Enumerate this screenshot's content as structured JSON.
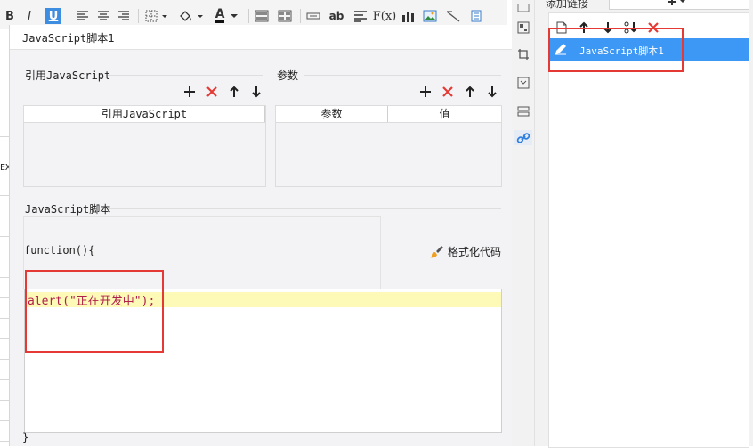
{
  "toolbar": {
    "bold": "B",
    "italic": "I",
    "underline": "U",
    "text_abbr": "ab",
    "formula": "F(x)",
    "font_color_letter": "A"
  },
  "grid": {
    "cell_fragment": "EX"
  },
  "dialog": {
    "title": "JavaScript脚本1",
    "imports": {
      "label": "引用JavaScript",
      "column": "引用JavaScript"
    },
    "params": {
      "label": "参数",
      "col_param": "参数",
      "col_value": "值"
    },
    "script": {
      "label": "JavaScript脚本",
      "function_header": "function(){",
      "format_button": "格式化代码",
      "code_line": "alert(\"正在开发中\");",
      "closing_brace": "}"
    }
  },
  "right_panel": {
    "title": "添加链接",
    "selected_item": "JavaScript脚本1"
  },
  "colors": {
    "accent_blue": "#3d97f5",
    "delete_red": "#e53935",
    "highlight_yellow": "#fdf9b7",
    "string_red": "#b0204a"
  }
}
